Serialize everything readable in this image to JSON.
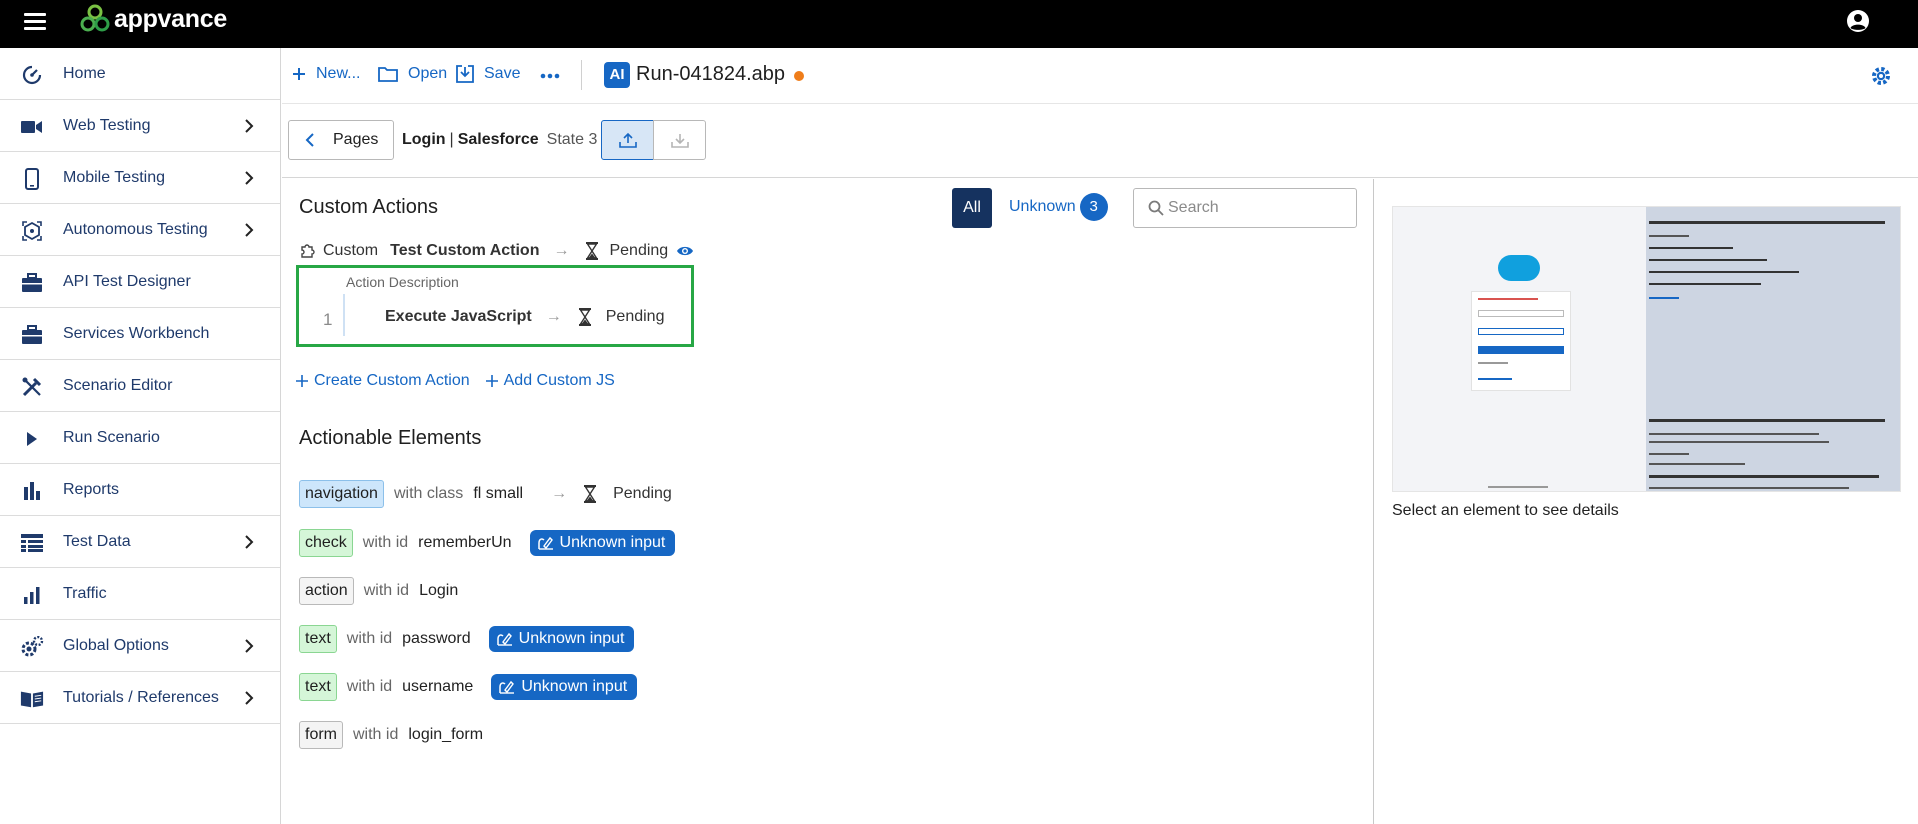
{
  "app": {
    "name": "appvance"
  },
  "sidebar": {
    "items": [
      {
        "label": "Home",
        "icon": "dashboard-gauge-icon",
        "has_children": false
      },
      {
        "label": "Web Testing",
        "icon": "video-camera-icon",
        "has_children": true
      },
      {
        "label": "Mobile Testing",
        "icon": "mobile-phone-icon",
        "has_children": true
      },
      {
        "label": "Autonomous Testing",
        "icon": "autonomous-cube-icon",
        "has_children": true
      },
      {
        "label": "API Test Designer",
        "icon": "briefcase-icon",
        "has_children": false
      },
      {
        "label": "Services Workbench",
        "icon": "briefcase-icon",
        "has_children": false
      },
      {
        "label": "Scenario Editor",
        "icon": "tools-icon",
        "has_children": false
      },
      {
        "label": "Run Scenario",
        "icon": "play-icon",
        "has_children": false
      },
      {
        "label": "Reports",
        "icon": "bar-chart-icon",
        "has_children": false
      },
      {
        "label": "Test Data",
        "icon": "table-list-icon",
        "has_children": true
      },
      {
        "label": "Traffic",
        "icon": "signal-bars-icon",
        "has_children": false
      },
      {
        "label": "Global Options",
        "icon": "gears-icon",
        "has_children": true
      },
      {
        "label": "Tutorials / References",
        "icon": "book-icon",
        "has_children": true
      }
    ]
  },
  "toolbar": {
    "new_label": "New...",
    "open_label": "Open",
    "save_label": "Save",
    "ai_badge": "AI",
    "file_name": "Run-041824.abp"
  },
  "pagebar": {
    "pages_label": "Pages",
    "crumb_page": "Login",
    "crumb_separator": "|",
    "crumb_site": "Salesforce",
    "crumb_state": "State 3"
  },
  "custom_actions": {
    "title": "Custom Actions",
    "filter_all": "All",
    "filter_unknown": "Unknown",
    "unknown_count": "3",
    "search_placeholder": "Search",
    "custom_label": "Custom",
    "custom_name": "Test Custom Action",
    "custom_status": "Pending",
    "action_description_label": "Action Description",
    "action_number": "1",
    "action_name": "Execute JavaScript",
    "action_status": "Pending",
    "create_link": "Create Custom Action",
    "add_js_link": "Add Custom JS"
  },
  "actionable_elements": {
    "title": "Actionable Elements",
    "items": [
      {
        "tag": "navigation",
        "with": "with class",
        "value": "fl small",
        "status": "Pending"
      },
      {
        "tag": "check",
        "with": "with id",
        "value": "rememberUn",
        "badge": "Unknown input"
      },
      {
        "tag": "action",
        "with": "with id",
        "value": "Login"
      },
      {
        "tag": "text",
        "with": "with id",
        "value": "password",
        "badge": "Unknown input"
      },
      {
        "tag": "text",
        "with": "with id",
        "value": "username",
        "badge": "Unknown input"
      },
      {
        "tag": "form",
        "with": "with id",
        "value": "login_form"
      }
    ]
  },
  "details": {
    "empty_text": "Select an element to see details"
  },
  "colors": {
    "accent": "#1667c4",
    "unsaved_dot": "#ef7d1a",
    "highlight_border": "#27a745",
    "topbar": "#000000",
    "filter_active": "#15325f"
  }
}
